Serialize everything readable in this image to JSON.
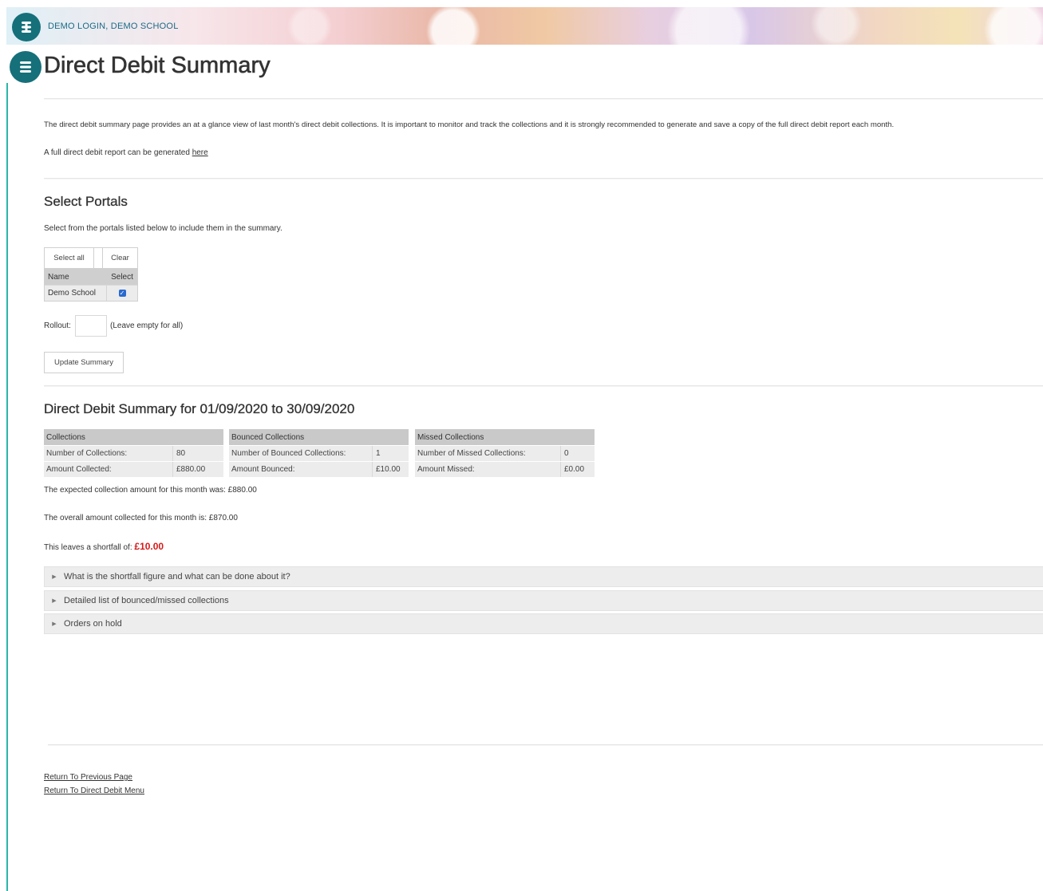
{
  "header": {
    "banner_text": "DEMO LOGIN, DEMO SCHOOL",
    "title": "Direct Debit Summary",
    "brand_color": "#15707a"
  },
  "intro": {
    "description": "The direct debit summary page provides an at a glance view of last month's direct debit collections. It is important to monitor and track the collections and it is strongly recommended to generate and save a copy of the full direct debit report each month.",
    "report_prefix": "A full direct debit report can be generated ",
    "report_link": "here"
  },
  "portals": {
    "heading": "Select Portals",
    "instructions": "Select from the portals listed below to include them in the summary.",
    "select_all_label": "Select all",
    "clear_label": "Clear",
    "columns": [
      "Name",
      "Select"
    ],
    "rows": [
      {
        "name": "Demo School",
        "selected": true
      }
    ],
    "rollout_label": "Rollout:",
    "rollout_value": "",
    "rollout_hint": "(Leave empty for all)",
    "update_label": "Update Summary"
  },
  "summary": {
    "heading": "Direct Debit Summary for 01/09/2020 to 30/09/2020",
    "collections": {
      "header": "Collections",
      "rows": [
        {
          "label": "Number of Collections:",
          "value": "80"
        },
        {
          "label": "Amount Collected:",
          "value": "£880.00"
        }
      ]
    },
    "bounced": {
      "header": "Bounced Collections",
      "rows": [
        {
          "label": "Number of Bounced Collections:",
          "value": "1"
        },
        {
          "label": "Amount Bounced:",
          "value": "£10.00"
        }
      ]
    },
    "missed": {
      "header": "Missed Collections",
      "rows": [
        {
          "label": "Number of Missed Collections:",
          "value": "0"
        },
        {
          "label": "Amount Missed:",
          "value": "£0.00"
        }
      ]
    },
    "expected_text": "The expected collection amount for this month was: £880.00",
    "overall_text": "The overall amount collected for this month is: £870.00",
    "shortfall_prefix": "This leaves a shortfall of: ",
    "shortfall_value": "£10.00",
    "shortfall_color": "#d21b1b"
  },
  "accordion": [
    {
      "label": "What is the shortfall figure and what can be done about it?"
    },
    {
      "label": "Detailed list of bounced/missed collections"
    },
    {
      "label": "Orders on hold"
    }
  ],
  "footer": {
    "previous_link": "Return To Previous Page",
    "menu_link": "Return To Direct Debit Menu"
  }
}
